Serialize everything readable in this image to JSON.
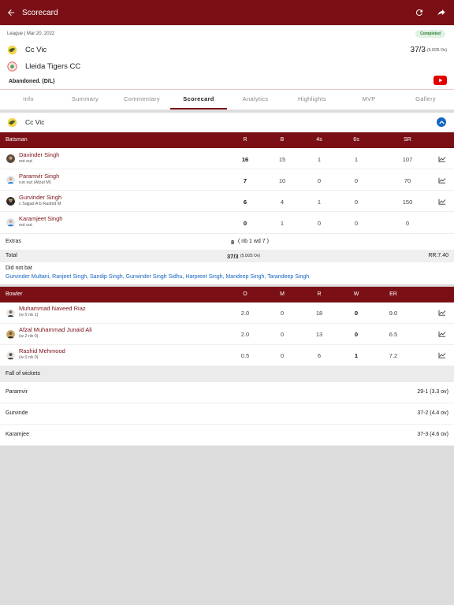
{
  "header": {
    "title": "Scorecard"
  },
  "match": {
    "meta": "League | Mar 20, 2022",
    "status": "Completed",
    "team1": {
      "name": "Cc Vic",
      "score": "37/3",
      "overs": "(5.0/25 Ov)"
    },
    "team2": {
      "name": "Lleida Tigers CC"
    },
    "result": "Abandoned. (D/L)"
  },
  "tabs": [
    "Info",
    "Summary",
    "Commentary",
    "Scorecard",
    "Analytics",
    "Highlights",
    "MVP",
    "Gallery"
  ],
  "innings": {
    "team": "Cc Vic"
  },
  "batting": {
    "headers": {
      "player": "Batsman",
      "r": "R",
      "b": "B",
      "fours": "4s",
      "sixes": "6s",
      "sr": "SR"
    },
    "rows": [
      {
        "name": "Davinder Singh",
        "desc": "not out",
        "r": "16",
        "b": "15",
        "fours": "1",
        "sixes": "1",
        "sr": "107"
      },
      {
        "name": "Paramvir Singh",
        "desc": "run out (Afzal M)",
        "r": "7",
        "b": "10",
        "fours": "0",
        "sixes": "0",
        "sr": "70"
      },
      {
        "name": "Gurvinder Singh",
        "desc": "c Sajjad A b Rashid M",
        "r": "6",
        "b": "4",
        "fours": "1",
        "sixes": "0",
        "sr": "150"
      },
      {
        "name": "Karamjeet Singh",
        "desc": "not out",
        "r": "0",
        "b": "1",
        "fours": "0",
        "sixes": "0",
        "sr": "0"
      }
    ],
    "extras_label": "Extras",
    "extras_value": "8",
    "extras_detail": "( nb 1 wd 7 )",
    "total_label": "Total",
    "total_value": "37/3",
    "total_overs": "(5.0/25 Ov)",
    "run_rate": "RR:7.40",
    "dnb_label": "Did not bat",
    "dnb_players": "Gurvinder Multani, Ranjeet Singh, Sandip Singh, Gurwinder Singh Sidhu, Harpreet Singh, Mandeep Singh, Tarandeep Singh"
  },
  "bowling": {
    "headers": {
      "player": "Bowler",
      "o": "O",
      "m": "M",
      "r": "R",
      "w": "W",
      "er": "ER"
    },
    "rows": [
      {
        "name": "Muhammad Naveed Riaz",
        "desc": "(w 5 nb 1)",
        "o": "2.0",
        "m": "0",
        "r": "18",
        "w": "0",
        "er": "9.0"
      },
      {
        "name": "Afzal Muhammad Junaid Ali",
        "desc": "(w 2 nb 0)",
        "o": "2.0",
        "m": "0",
        "r": "13",
        "w": "0",
        "er": "6.5"
      },
      {
        "name": "Rashid Mehmood",
        "desc": "(w 0 nb 0)",
        "o": "0.5",
        "m": "0",
        "r": "6",
        "w": "1",
        "er": "7.2"
      }
    ]
  },
  "fall_of_wickets": {
    "title": "Fall of wickets",
    "rows": [
      {
        "name": "Paramvir",
        "value": "29-1 (3.3 ov)"
      },
      {
        "name": "Gurvinde",
        "value": "37-2 (4.4 ov)"
      },
      {
        "name": "Karamjee",
        "value": "37-3 (4.6 ov)"
      }
    ]
  },
  "colors": {
    "brand": "#7a1016",
    "link": "#1565c0",
    "completed": "#2e7d32"
  }
}
